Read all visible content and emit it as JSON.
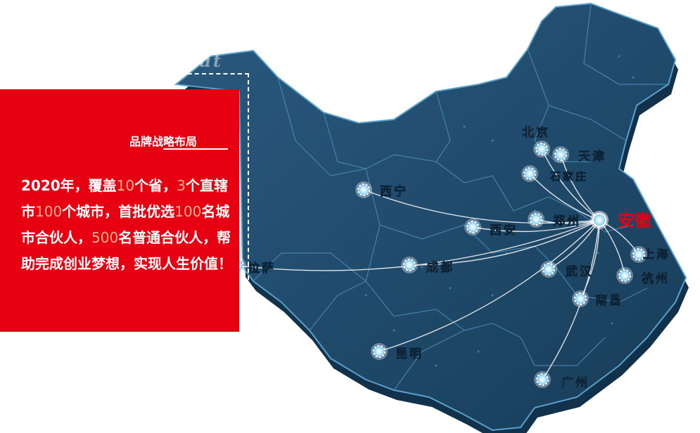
{
  "panel": {
    "heading": "品牌战略布局",
    "watermark": "About",
    "text_parts": [
      {
        "t": "2020年，覆盖",
        "hl": false
      },
      {
        "t": "10",
        "hl": true
      },
      {
        "t": "个省，",
        "hl": false
      },
      {
        "t": "3",
        "hl": true
      },
      {
        "t": "个直辖市",
        "hl": false
      },
      {
        "t": "100",
        "hl": true
      },
      {
        "t": "个城市，首批优选",
        "hl": false
      },
      {
        "t": "100",
        "hl": true
      },
      {
        "t": "名城市合伙人，",
        "hl": false
      },
      {
        "t": "500",
        "hl": true
      },
      {
        "t": "名普通合伙人，帮助完成创业梦想，实现人生价值！",
        "hl": false
      }
    ]
  },
  "hub": {
    "name": "安徽",
    "color": "#e60012"
  },
  "cities": [
    {
      "key": "beijing",
      "name": "北京"
    },
    {
      "key": "tianjin",
      "name": "天津"
    },
    {
      "key": "shijiazhuang",
      "name": "石家庄"
    },
    {
      "key": "xining",
      "name": "西宁"
    },
    {
      "key": "xian",
      "name": "西安"
    },
    {
      "key": "zhengzhou",
      "name": "郑州"
    },
    {
      "key": "shanghai",
      "name": "上海"
    },
    {
      "key": "chengdu",
      "name": "成都"
    },
    {
      "key": "wuhan",
      "name": "武汉"
    },
    {
      "key": "hangzhou",
      "name": "杭州"
    },
    {
      "key": "nanchang",
      "name": "南昌"
    },
    {
      "key": "lasa",
      "name": "拉萨"
    },
    {
      "key": "kunming",
      "name": "昆明"
    },
    {
      "key": "guangzhou",
      "name": "广州"
    }
  ],
  "colors": {
    "map_fill": "#1f4c6e",
    "map_edge": "#3d7fa8",
    "label_color": "#f5e04a",
    "panel": "#e60012",
    "highlight": "#f9b28e"
  }
}
